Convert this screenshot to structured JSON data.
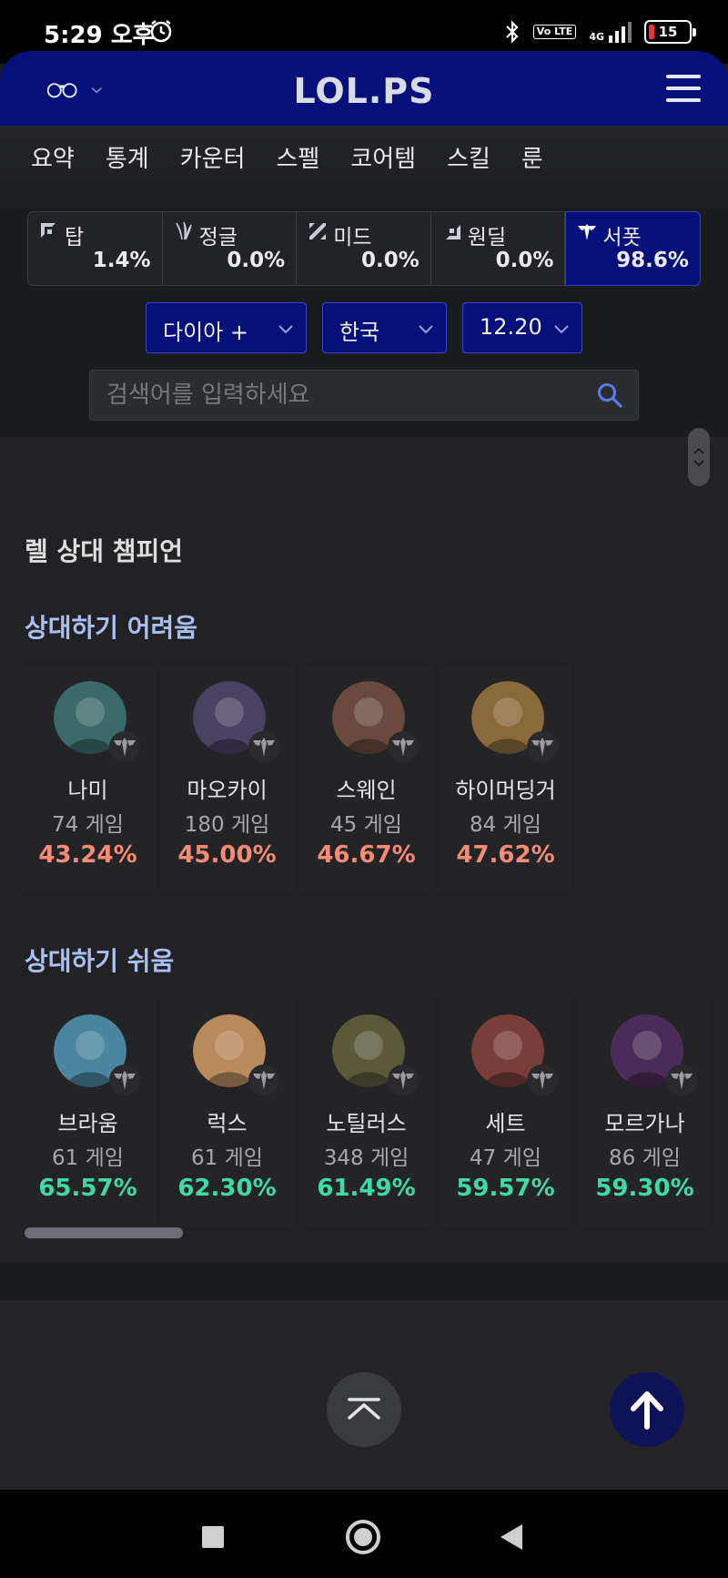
{
  "status_bar": {
    "time": "5:29 오후",
    "battery": "15",
    "network": "4G",
    "volte": "Vo LTE"
  },
  "header": {
    "logo": "LOL.PS"
  },
  "tabs": [
    "요약",
    "통계",
    "카운터",
    "스펠",
    "코어템",
    "스킬",
    "룬"
  ],
  "positions": [
    {
      "name": "탑",
      "rate": "1.4%",
      "icon": "top-lane-icon"
    },
    {
      "name": "정글",
      "rate": "0.0%",
      "icon": "jungle-icon"
    },
    {
      "name": "미드",
      "rate": "0.0%",
      "icon": "mid-lane-icon"
    },
    {
      "name": "원딜",
      "rate": "0.0%",
      "icon": "bottom-lane-icon"
    },
    {
      "name": "서폿",
      "rate": "98.6%",
      "icon": "support-icon",
      "active": true
    }
  ],
  "filters": {
    "tier": "다이아 +",
    "region": "한국",
    "patch": "12.20"
  },
  "search": {
    "placeholder": "검색어를 입력하세요"
  },
  "section": {
    "title": "렐 상대 챔피언",
    "hard_title": "상대하기 어려움",
    "easy_title": "상대하기 쉬움"
  },
  "hard": [
    {
      "name": "나미",
      "games": "74 게임",
      "rate": "43.24%",
      "color": "#3c6a6a"
    },
    {
      "name": "마오카이",
      "games": "180 게임",
      "rate": "45.00%",
      "color": "#4a4263"
    },
    {
      "name": "스웨인",
      "games": "45 게임",
      "rate": "46.67%",
      "color": "#6a4a3e"
    },
    {
      "name": "하이머딩거",
      "games": "84 게임",
      "rate": "47.62%",
      "color": "#8a6a3a"
    }
  ],
  "easy": [
    {
      "name": "브라움",
      "games": "61 게임",
      "rate": "65.57%",
      "color": "#4a86a0"
    },
    {
      "name": "럭스",
      "games": "61 게임",
      "rate": "62.30%",
      "color": "#b88a5c"
    },
    {
      "name": "노틸러스",
      "games": "348 게임",
      "rate": "61.49%",
      "color": "#5a5a3a"
    },
    {
      "name": "세트",
      "games": "47 게임",
      "rate": "59.57%",
      "color": "#7a3e3a"
    },
    {
      "name": "모르가나",
      "games": "86 게임",
      "rate": "59.30%",
      "color": "#4a2c5a"
    }
  ],
  "colors": {
    "brand": "#05107a",
    "bad": "#f58b77",
    "good": "#3fd9a6",
    "accent": "#a9c0f5"
  }
}
